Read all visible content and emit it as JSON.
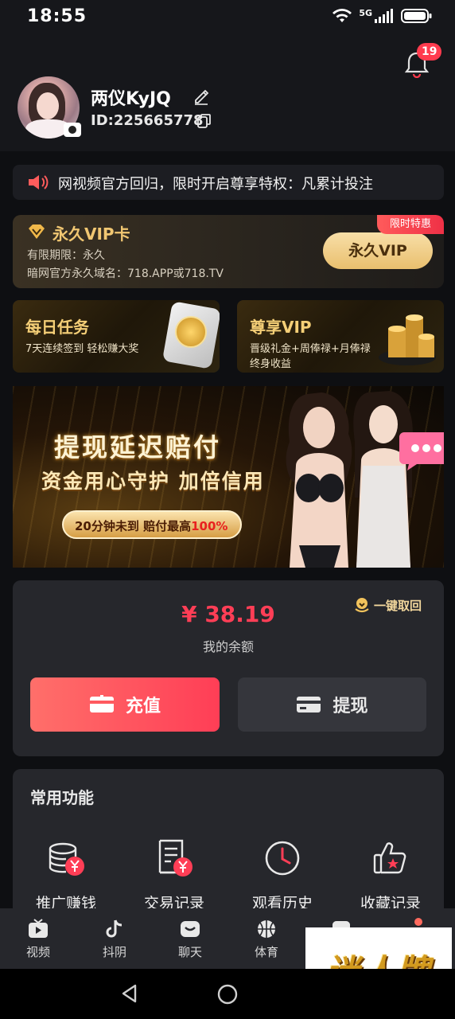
{
  "status_bar": {
    "time": "18:55",
    "network": "5G"
  },
  "notifications": {
    "badge_count": "19"
  },
  "profile": {
    "username": "两仪KyJQ",
    "user_id": "ID:225665778"
  },
  "notice": {
    "text": "网视频官方回归，限时开启尊享特权：凡累计投注"
  },
  "vip_card": {
    "title": "永久VIP卡",
    "validity": "有限期限：永久",
    "domain": "暗网官方永久域名：718.APP或718.TV",
    "button_label": "永久VIP",
    "tag": "限时特惠"
  },
  "promos": {
    "daily": {
      "title": "每日任务",
      "subtitle": "7天连续签到 轻松赚大奖"
    },
    "vip": {
      "title": "尊享VIP",
      "subtitle_line1": "晋级礼金+周俸禄+月俸禄",
      "subtitle_line2": "终身收益"
    }
  },
  "banner": {
    "title": "提现延迟赔付",
    "subtitle": "资金用心守护 加倍信用",
    "pill_prefix": "20分钟未到 赔付最高",
    "pill_highlight": "100%"
  },
  "balance": {
    "amount": "¥ 38.19",
    "label": "我的余额",
    "recall_label": "一键取回",
    "recharge_label": "充值",
    "withdraw_label": "提现"
  },
  "functions": {
    "title": "常用功能",
    "items": [
      {
        "label": "推广赚钱",
        "icon": "coins-yen-icon"
      },
      {
        "label": "交易记录",
        "icon": "receipt-yen-icon"
      },
      {
        "label": "观看历史",
        "icon": "clock-icon"
      },
      {
        "label": "收藏记录",
        "icon": "thumbs-up-star-icon"
      }
    ]
  },
  "tabbar": {
    "items": [
      {
        "label": "视频",
        "icon": "tv-icon"
      },
      {
        "label": "抖阴",
        "icon": "tiktok-icon"
      },
      {
        "label": "聊天",
        "icon": "chat-icon"
      },
      {
        "label": "体育",
        "icon": "basketball-icon"
      }
    ]
  },
  "watermark": {
    "text": "迷人牌"
  },
  "colors": {
    "accent_red": "#ff3e56",
    "gold": "#f1c772",
    "background": "#16171b",
    "card": "#26272c"
  }
}
